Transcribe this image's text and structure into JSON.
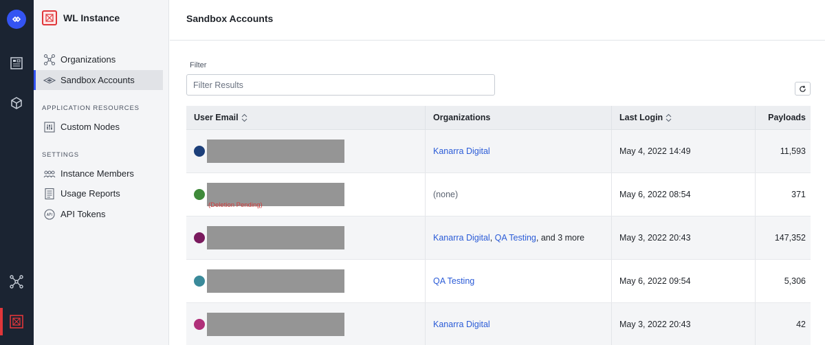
{
  "sidenav": {
    "instance_title": "WL Instance",
    "items": [
      {
        "label": "Organizations"
      },
      {
        "label": "Sandbox Accounts"
      }
    ],
    "sections": [
      {
        "label": "APPLICATION RESOURCES",
        "items": [
          {
            "label": "Custom Nodes"
          }
        ]
      },
      {
        "label": "SETTINGS",
        "items": [
          {
            "label": "Instance Members"
          },
          {
            "label": "Usage Reports"
          },
          {
            "label": "API Tokens"
          }
        ]
      }
    ]
  },
  "header": {
    "title": "Sandbox Accounts"
  },
  "filter": {
    "label": "Filter",
    "placeholder": "Filter Results"
  },
  "table": {
    "columns": [
      "User Email",
      "Organizations",
      "Last Login",
      "Payloads"
    ],
    "rows": [
      {
        "avatar_color": "#1c3f7a",
        "pending": "",
        "orgs": [
          {
            "name": "Kanarra Digital",
            "sep": ""
          }
        ],
        "orgs_extra": "",
        "orgs_none": "",
        "last_login": "May 4, 2022 14:49",
        "payloads": "11,593"
      },
      {
        "avatar_color": "#3f8a3a",
        "pending": "(Deletion Pending)",
        "orgs": [],
        "orgs_extra": "",
        "orgs_none": "(none)",
        "last_login": "May 6, 2022 08:54",
        "payloads": "371"
      },
      {
        "avatar_color": "#7a1a5e",
        "pending": "",
        "orgs": [
          {
            "name": "Kanarra Digital",
            "sep": ","
          },
          {
            "name": "QA Testing",
            "sep": ","
          }
        ],
        "orgs_extra": "and 3 more",
        "orgs_none": "",
        "last_login": "May 3, 2022 20:43",
        "payloads": "147,352"
      },
      {
        "avatar_color": "#3a8a9a",
        "pending": "",
        "orgs": [
          {
            "name": "QA Testing",
            "sep": ""
          }
        ],
        "orgs_extra": "",
        "orgs_none": "",
        "last_login": "May 6, 2022 09:54",
        "payloads": "5,306"
      },
      {
        "avatar_color": "#b0307a",
        "pending": "",
        "orgs": [
          {
            "name": "Kanarra Digital",
            "sep": ""
          }
        ],
        "orgs_extra": "",
        "orgs_none": "",
        "last_login": "May 3, 2022 20:43",
        "payloads": "42"
      }
    ]
  },
  "icons": {
    "rail": [
      "logo-icon",
      "dashboard-icon",
      "cube-icon",
      "network-icon",
      "instance-icon"
    ],
    "accent": "#3454f2",
    "danger": "#e0363a",
    "link": "#2a5bd7"
  }
}
